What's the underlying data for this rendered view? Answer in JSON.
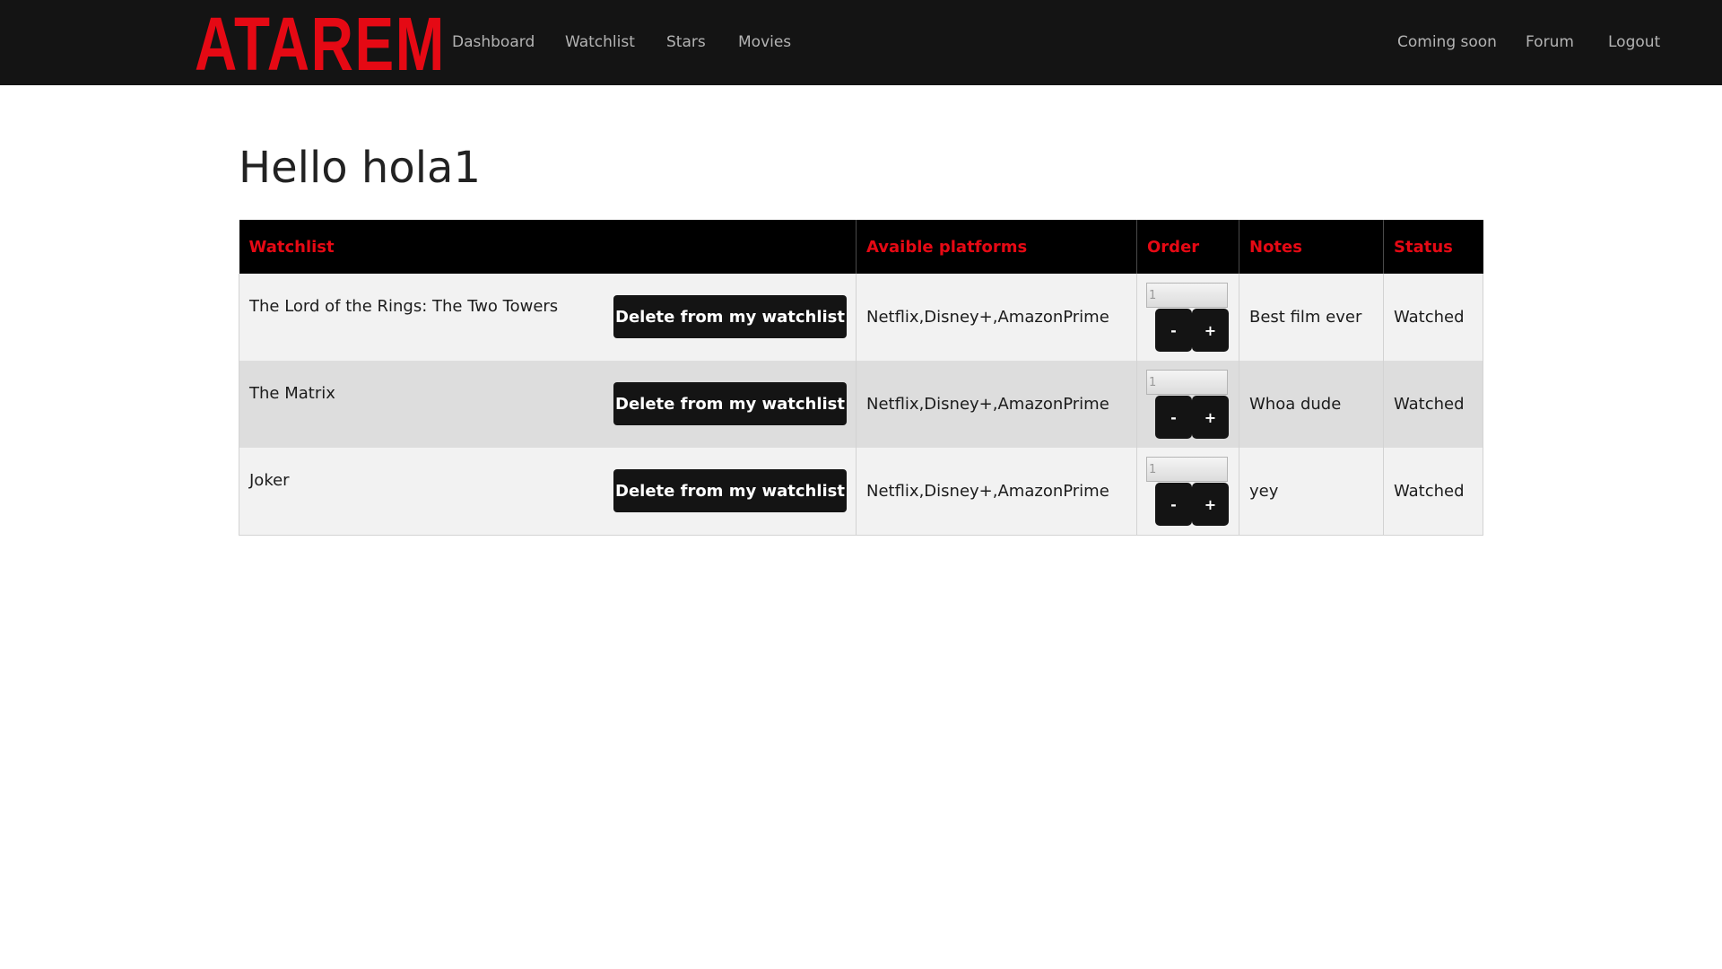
{
  "brand": {
    "logo_text": "ATAREM",
    "accent_color": "#e50914"
  },
  "nav": {
    "left": [
      "Dashboard",
      "Watchlist",
      "Stars",
      "Movies"
    ],
    "right": [
      "Coming soon",
      "Forum",
      "Logout"
    ]
  },
  "page": {
    "greeting": "Hello hola1"
  },
  "table": {
    "headers": [
      "Watchlist",
      "Avaible platforms",
      "Order",
      "Notes",
      "Status"
    ],
    "rows": [
      {
        "title": "The Lord of the Rings: The Two Towers",
        "delete_label": "Delete from my watchlist",
        "platforms": "Netflix,Disney+,AmazonPrime",
        "order": "1",
        "minus_label": "-",
        "plus_label": "+",
        "notes": "Best film ever",
        "status": "Watched"
      },
      {
        "title": "The Matrix",
        "delete_label": "Delete from my watchlist",
        "platforms": "Netflix,Disney+,AmazonPrime",
        "order": "1",
        "minus_label": "-",
        "plus_label": "+",
        "notes": "Whoa dude",
        "status": "Watched"
      },
      {
        "title": "Joker",
        "delete_label": "Delete from my watchlist",
        "platforms": "Netflix,Disney+,AmazonPrime",
        "order": "1",
        "minus_label": "-",
        "plus_label": "+",
        "notes": "yey",
        "status": "Watched"
      }
    ]
  }
}
